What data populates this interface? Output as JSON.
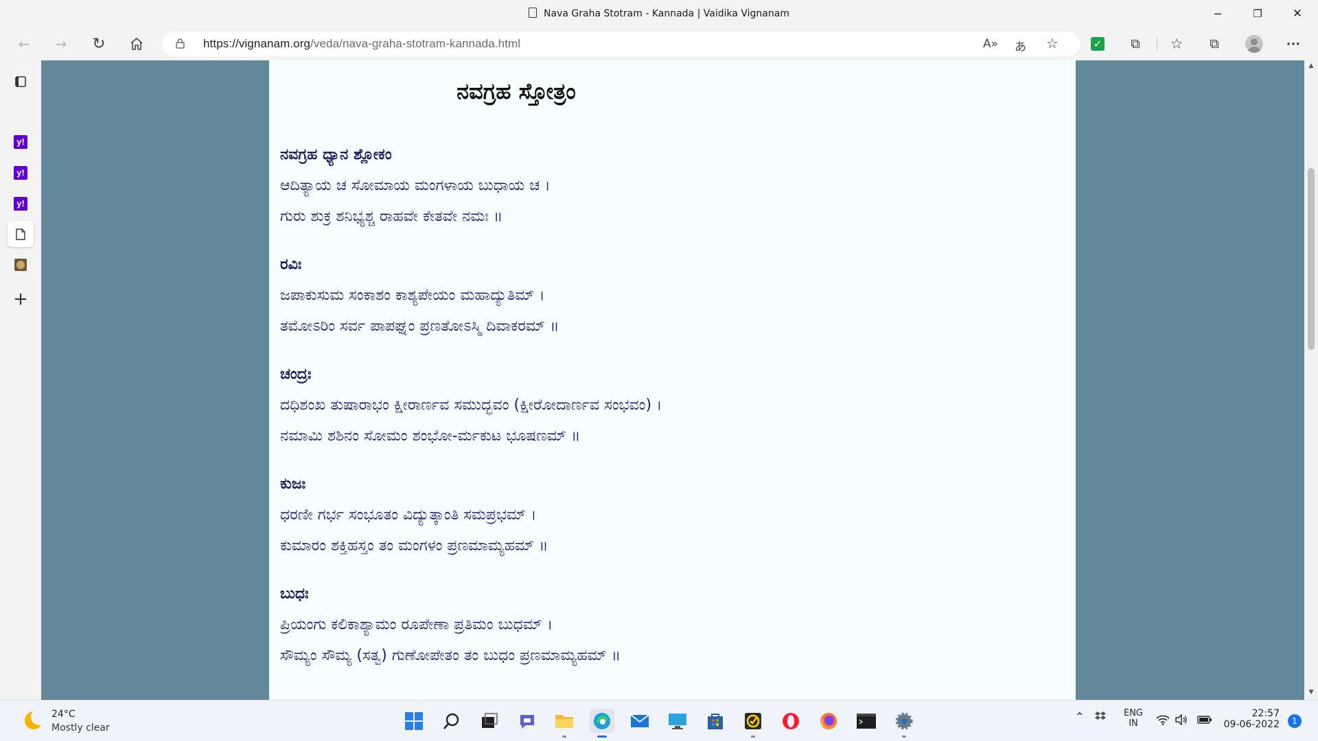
{
  "window": {
    "title": "Nava Graha Stotram - Kannada | Vaidika Vignanam",
    "minimize": "─",
    "restore": "❐",
    "close": "✕"
  },
  "toolbar": {
    "url_domain": "https://vignanam.org",
    "url_path": "/veda/nava-graha-stotram-kannada.html",
    "back_icon": "←",
    "forward_icon": "→",
    "refresh_icon": "↻",
    "read_aloud_icon": "A»",
    "translate_icon": "あ",
    "favorite_icon": "☆",
    "extensions_icon": "⧉",
    "favorites_icon": "☆",
    "collections_icon": "⧉",
    "more_icon": "···"
  },
  "sidebar": {
    "add_icon": "+"
  },
  "article": {
    "title": "ನವಗ್ರಹ ಸ್ತೋತ್ರಂ",
    "sections": [
      {
        "heading": "ನವಗ್ರಹ ಧ್ಯಾನ ಶ್ಲೋಕಂ",
        "lines": [
          "ಆದಿತ್ಯಾಯ ಚ ಸೋಮಾಯ ಮಂಗಳಾಯ ಬುಧಾಯ ಚ ।",
          "ಗುರು ಶುಕ್ರ ಶನಿಭ್ಯಶ್ಚ ರಾಹವೇ ಕೇತವೇ ನಮಃ ॥"
        ]
      },
      {
        "heading": "ರವಿಃ",
        "lines": [
          "ಜಪಾಕುಸುಮ ಸಂಕಾಶಂ ಕಾಶ್ಯಪೇಯಂ ಮಹಾದ್ಯುತಿಮ್ ।",
          "ತಮೋಽರಿಂ ಸರ್ವ ಪಾಪಘ್ನಂ ಪ್ರಣತೋಽಸ್ಮಿ ದಿವಾಕರಮ್ ॥"
        ]
      },
      {
        "heading": "ಚಂದ್ರಃ",
        "lines": [
          "ದಧಿಶಂಖ ತುಷಾರಾಭಂ ಕ್ಷೀರಾರ್ಣವ ಸಮುದ್ಭವಂ (ಕ್ಷೀರೋದಾರ್ಣವ ಸಂಭವಂ) ।",
          "ನಮಾಮಿ ಶಶಿನಂ ಸೋಮಂ ಶಂಭೋ-ರ್ಮಕುಟ ಭೂಷಣಮ್ ॥"
        ]
      },
      {
        "heading": "ಕುಜಃ",
        "lines": [
          "ಧರಣೀ ಗರ್ಭ ಸಂಭೂತಂ ವಿದ್ಯುತ್ಕಾಂತಿ ಸಮಪ್ರಭಮ್ ।",
          "ಕುಮಾರಂ ಶಕ್ತಿಹಸ್ತಂ ತಂ ಮಂಗಳಂ ಪ್ರಣಮಾಮ್ಯಹಮ್ ॥"
        ]
      },
      {
        "heading": "ಬುಧಃ",
        "lines": [
          "ಪ್ರಿಯಂಗು ಕಲಿಕಾಶ್ಯಾಮಂ ರೂಪೇಣಾ ಪ್ರತಿಮಂ ಬುಧಮ್ ।",
          "ಸೌಮ್ಯಂ ಸೌಮ್ಯ (ಸತ್ವ) ಗುಣೋಪೇತಂ ತಂ ಬುಧಂ ಪ್ರಣಮಾಮ್ಯಹಮ್ ॥"
        ]
      }
    ]
  },
  "taskbar": {
    "weather_temp": "24°C",
    "weather_condition": "Mostly clear",
    "language_line1": "ENG",
    "language_line2": "IN",
    "time": "22:57",
    "date": "09-06-2022",
    "notification_count": "1"
  }
}
